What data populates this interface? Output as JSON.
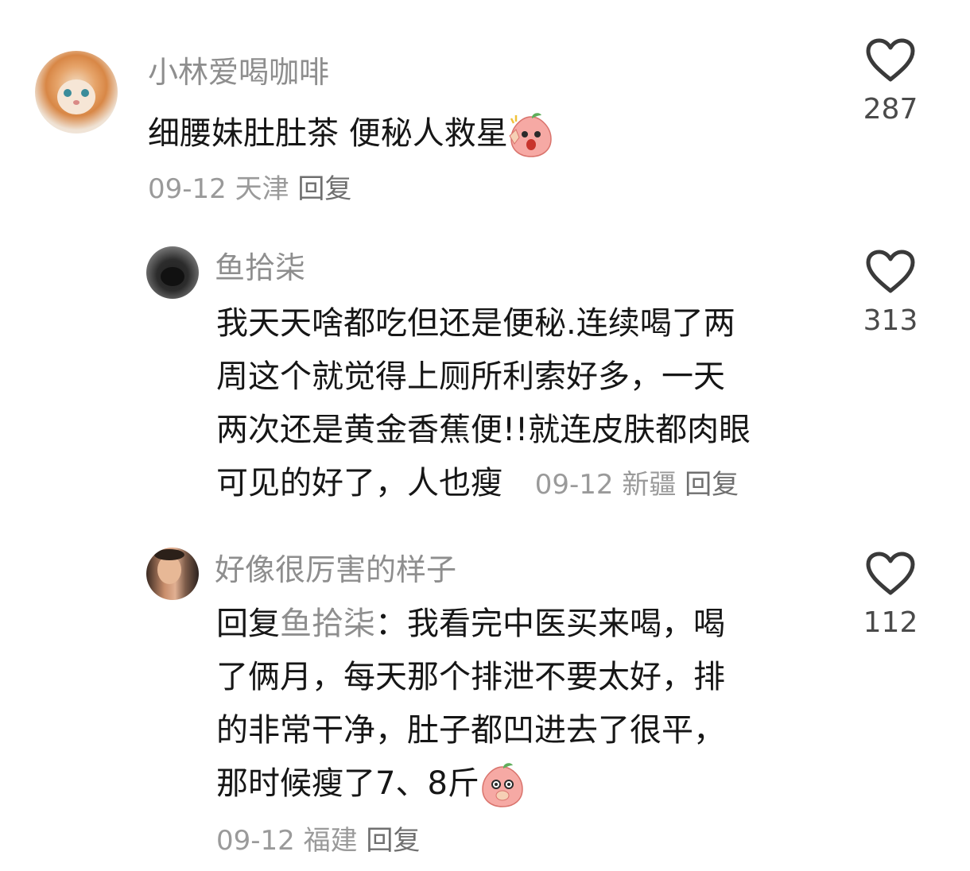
{
  "comments": [
    {
      "username": "小林爱喝咖啡",
      "text": "细腰妹肚肚茶 便秘人救星",
      "date": "09-12",
      "location": "天津",
      "reply_label": "回复",
      "likes": "287",
      "avatar_icon": "cat-avatar",
      "emoji_icon": "peach-wow-emoji"
    },
    {
      "username": "鱼拾柒",
      "text_lines": [
        "我天天啥都吃但还是便秘.连续喝了两",
        "周这个就觉得上厕所利索好多，一天",
        "两次还是黄金香蕉便!!就连皮肤都肉眼",
        "可见的好了，人也瘦"
      ],
      "date": "09-12",
      "location": "新疆",
      "reply_label": "回复",
      "likes": "313",
      "avatar_icon": "dog-avatar"
    },
    {
      "username": "好像很厉害的样子",
      "reply_prefix": "回复",
      "mention": "鱼拾柒",
      "text_lines": [
        "：我看完中医买来喝，喝",
        "了俩月，每天那个排泄不要太好，排",
        "的非常干净，肚子都凹进去了很平，",
        "那时候瘦了7、8斤"
      ],
      "date": "09-12",
      "location": "福建",
      "reply_label": "回复",
      "likes": "112",
      "avatar_icon": "person-avatar",
      "emoji_icon": "peach-shy-emoji"
    }
  ],
  "colors": {
    "username": "#8e8e8e",
    "text": "#161616",
    "meta": "#9a9a9a",
    "heart_stroke": "#3a3a3a",
    "emoji_peach": "#f6a9a4"
  }
}
